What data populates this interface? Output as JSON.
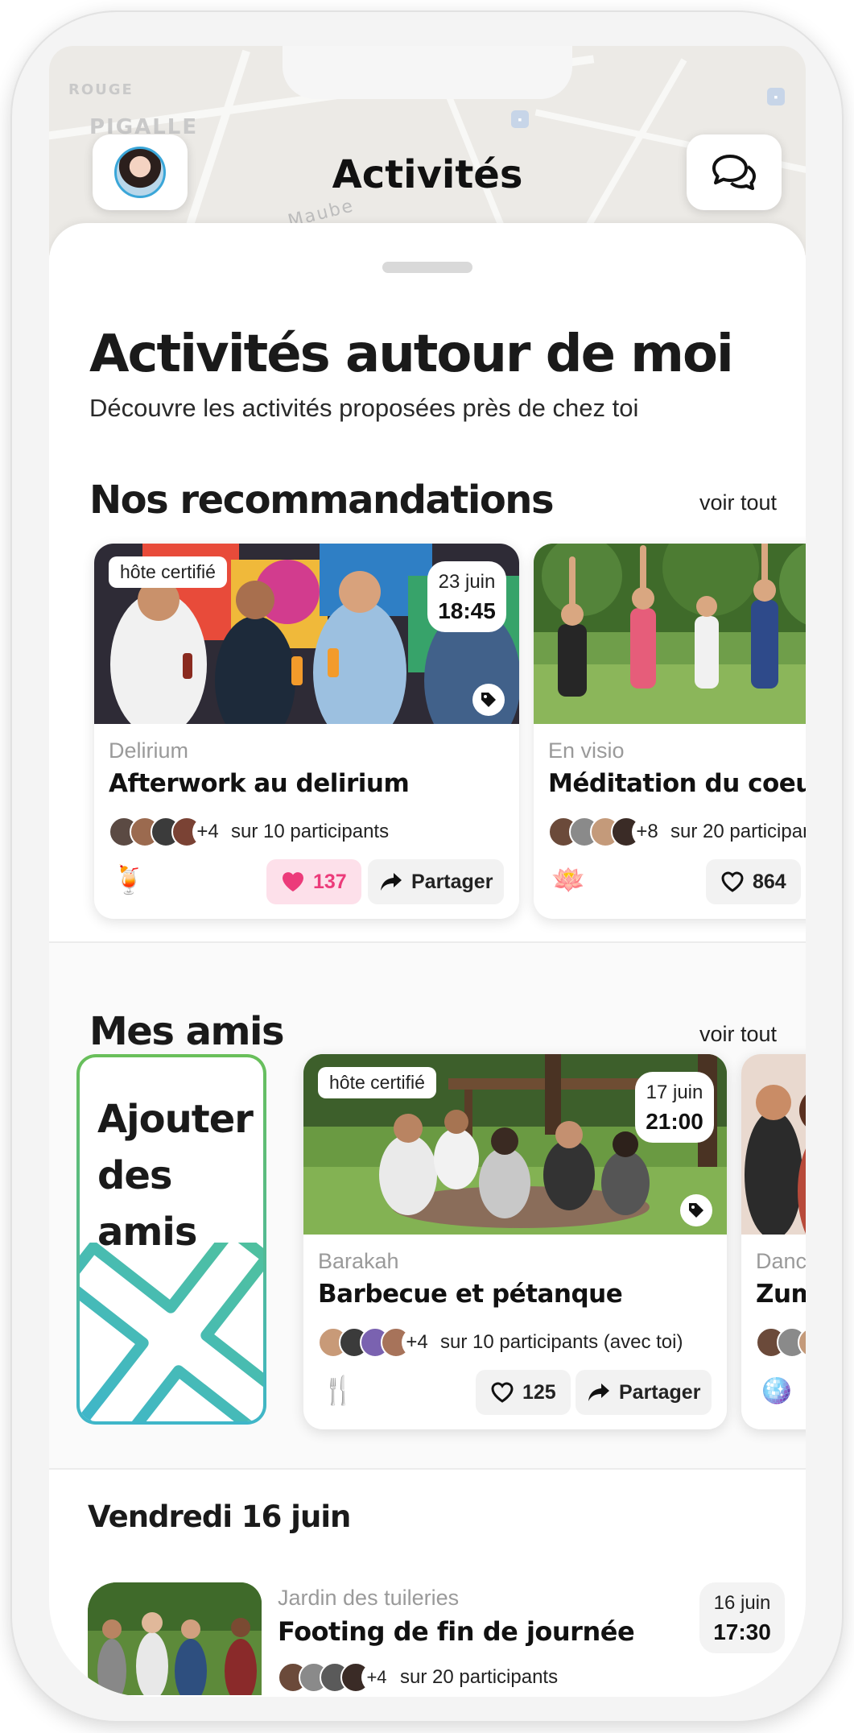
{
  "header": {
    "title": "Activités",
    "map_labels": [
      "ROUGE",
      "PIGALLE",
      "Maube"
    ]
  },
  "intro": {
    "title": "Activités autour de moi",
    "subtitle": "Découvre les activités proposées près de chez toi"
  },
  "recommendations": {
    "title": "Nos recommandations",
    "see_all": "voir tout",
    "cards": [
      {
        "host_badge": "hôte certifié",
        "date": "23 juin",
        "time": "18:45",
        "venue": "Delirium",
        "title": "Afterwork au delirium",
        "extra": "+4",
        "participants": "sur 10 participants",
        "likes": "137",
        "share": "Partager",
        "emoji": "🍹"
      },
      {
        "venue": "En visio",
        "title": "Méditation du coeur",
        "extra": "+8",
        "participants": "sur 20 participan",
        "likes": "864",
        "emoji": "🪷"
      }
    ]
  },
  "friends": {
    "title": "Mes amis",
    "see_all": "voir tout",
    "add_card": [
      "Ajouter",
      "des",
      "amis"
    ],
    "cards": [
      {
        "host_badge": "hôte certifié",
        "date": "17 juin",
        "time": "21:00",
        "venue": "Barakah",
        "title": "Barbecue et pétanque",
        "extra": "+4",
        "participants": "sur 10 participants (avec toi)",
        "likes": "125",
        "share": "Partager",
        "emoji": "🍴"
      },
      {
        "venue": "Dance",
        "title": "Zumb",
        "emoji": "🪩"
      }
    ]
  },
  "day": {
    "title": "Vendredi 16 juin",
    "item": {
      "venue": "Jardin des tuileries",
      "title": "Footing de fin de journée",
      "extra": "+4",
      "participants": "sur 20 participants",
      "date": "16 juin",
      "time": "17:30"
    }
  },
  "colors": {
    "like_active": "#ec3b7a",
    "add_gradient_top": "#69bf5a",
    "add_gradient_bottom": "#3fb6c9",
    "avatar_ring": "#3aa6d8"
  }
}
